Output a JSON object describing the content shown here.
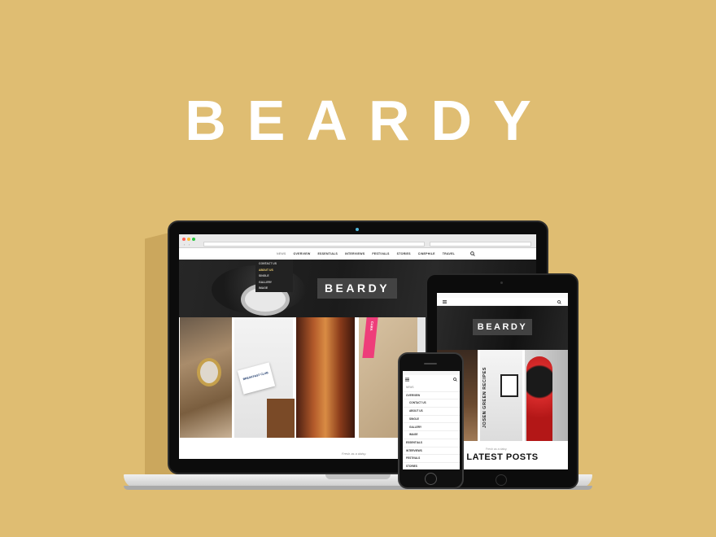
{
  "hero": {
    "title": "BEARDY"
  },
  "laptop": {
    "nav": [
      "NEWS",
      "OVERVIEW",
      "ESSENTIALS",
      "INTERVIEWS",
      "FESTIVALS",
      "STORIES",
      "CINEPHILE",
      "TRAVEL"
    ],
    "dropdown": [
      "CONTACT US",
      "ABOUT US",
      "SINGLE",
      "GALLERY",
      "IMAGE"
    ],
    "logo": "BEARDY",
    "tile2_card": "BREAKFAST CLUB",
    "tile4_label": "CARA",
    "footer_caption": "Fresh as a daisy."
  },
  "tablet": {
    "logo": "BEARDY",
    "tile_text": "JOSEN GREEN RECIPES",
    "post_caption": "Fresh as a daisy.",
    "latest": "LATEST POSTS"
  },
  "phone": {
    "menu": [
      "NEWS",
      "OVERVIEW",
      "CONTACT US",
      "ABOUT US",
      "SINGLE",
      "GALLERY",
      "IMAGE",
      "ESSENTIALS",
      "INTERVIEWS",
      "FESTIVALS",
      "STORIES"
    ]
  },
  "colors": {
    "background": "#dfbd72",
    "accent": "#f1d276",
    "pink": "#ee3d7a"
  }
}
